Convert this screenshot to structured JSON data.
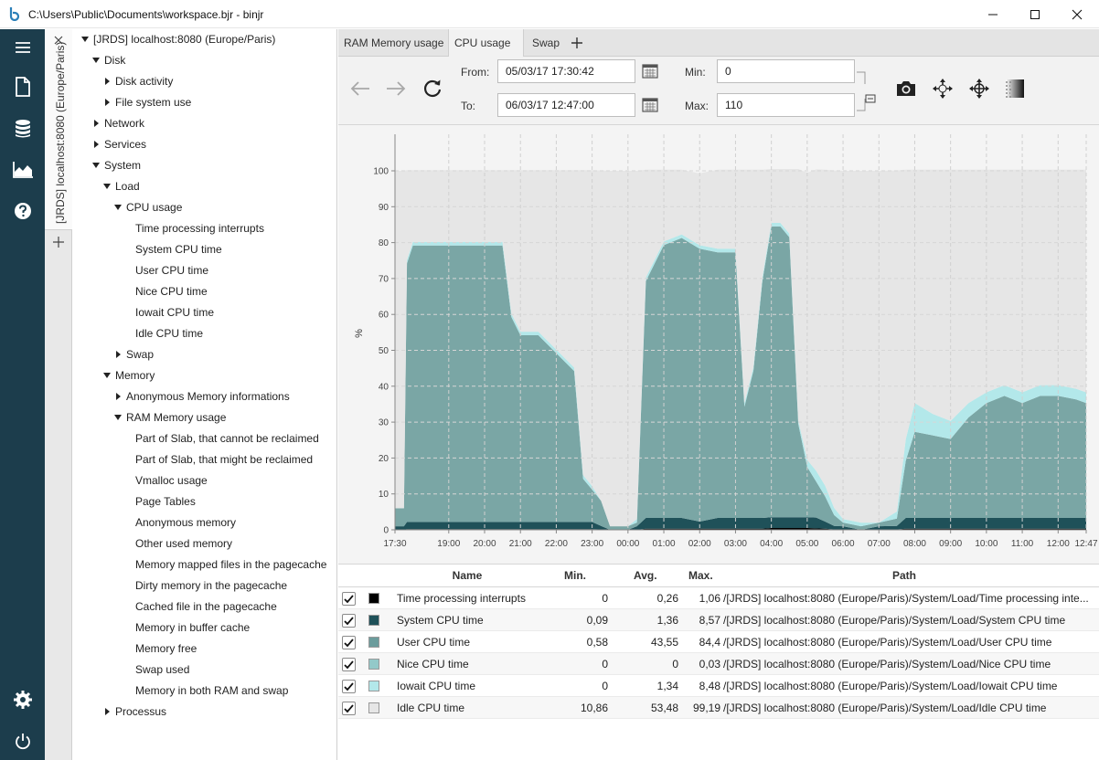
{
  "window": {
    "title": "C:\\Users\\Public\\Documents\\workspace.bjr - binjr",
    "buttons": {
      "minimize_icon": "minimize-icon",
      "maximize_icon": "maximize-icon",
      "close_icon": "close-icon"
    }
  },
  "nav": {
    "items": [
      "menu-icon",
      "new-document-icon",
      "database-icon",
      "chart-area-icon",
      "help-icon"
    ],
    "bottom": [
      "settings-icon",
      "power-icon"
    ]
  },
  "source": {
    "tab_label": "[JRDS] localhost:8080 (Europe/Paris)"
  },
  "tree": [
    {
      "label": "[JRDS] localhost:8080 (Europe/Paris)",
      "arrow": "down"
    },
    {
      "label": "Disk",
      "arrow": "down"
    },
    {
      "label": "Disk activity",
      "arrow": "right"
    },
    {
      "label": "File system use",
      "arrow": "right"
    },
    {
      "label": "Network",
      "arrow": "right"
    },
    {
      "label": "Services",
      "arrow": "right"
    },
    {
      "label": "System",
      "arrow": "down"
    },
    {
      "label": "Load",
      "arrow": "down"
    },
    {
      "label": "CPU usage",
      "arrow": "down"
    },
    {
      "label": "Time processing interrupts",
      "arrow": "none"
    },
    {
      "label": "System CPU time",
      "arrow": "none"
    },
    {
      "label": "User CPU time",
      "arrow": "none"
    },
    {
      "label": "Nice CPU time",
      "arrow": "none"
    },
    {
      "label": "Iowait CPU time",
      "arrow": "none"
    },
    {
      "label": "Idle CPU time",
      "arrow": "none"
    },
    {
      "label": "Swap",
      "arrow": "right"
    },
    {
      "label": "Memory",
      "arrow": "down"
    },
    {
      "label": "Anonymous Memory informations",
      "arrow": "right"
    },
    {
      "label": "RAM Memory usage",
      "arrow": "down"
    },
    {
      "label": "Part of Slab, that cannot be reclaimed",
      "arrow": "none"
    },
    {
      "label": "Part of Slab, that might be reclaimed",
      "arrow": "none"
    },
    {
      "label": "Vmalloc usage",
      "arrow": "none"
    },
    {
      "label": "Page Tables",
      "arrow": "none"
    },
    {
      "label": "Anonymous memory",
      "arrow": "none"
    },
    {
      "label": "Other used memory",
      "arrow": "none"
    },
    {
      "label": "Memory mapped files in the pagecache",
      "arrow": "none"
    },
    {
      "label": "Dirty memory in the pagecache",
      "arrow": "none"
    },
    {
      "label": "Cached file in the pagecache",
      "arrow": "none"
    },
    {
      "label": "Memory in buffer cache",
      "arrow": "none"
    },
    {
      "label": "Memory free",
      "arrow": "none"
    },
    {
      "label": "Swap used",
      "arrow": "none"
    },
    {
      "label": "Memory in both RAM and swap",
      "arrow": "none"
    },
    {
      "label": "Processus",
      "arrow": "right"
    }
  ],
  "tabs": [
    {
      "label": "RAM Memory usage",
      "active": false
    },
    {
      "label": "CPU usage",
      "active": true
    },
    {
      "label": "Swap",
      "active": false
    }
  ],
  "toolbar": {
    "from_label": "From:",
    "from_value": "05/03/17 17:30:42",
    "to_label": "To:",
    "to_value": "06/03/17 12:47:00",
    "min_label": "Min:",
    "min_value": "0",
    "max_label": "Max:",
    "max_value": "110"
  },
  "chart_data": {
    "type": "area",
    "ylabel": "%",
    "ylim": [
      0,
      100
    ],
    "yticks": [
      "0",
      "10",
      "20",
      "30",
      "40",
      "50",
      "60",
      "70",
      "80",
      "90",
      "100"
    ],
    "xticks": [
      "17:30",
      "19:00",
      "20:00",
      "21:00",
      "22:00",
      "23:00",
      "00:00",
      "01:00",
      "02:00",
      "03:00",
      "04:00",
      "05:00",
      "06:00",
      "07:00",
      "08:00",
      "09:00",
      "10:00",
      "11:00",
      "12:00",
      "12:47"
    ],
    "x": [
      "17:30",
      "17:45",
      "17:50",
      "18:00",
      "18:30",
      "19:00",
      "19:30",
      "20:00",
      "20:30",
      "20:45",
      "21:00",
      "21:30",
      "22:00",
      "22:30",
      "22:45",
      "23:00",
      "23:15",
      "23:30",
      "23:45",
      "00:00",
      "00:15",
      "00:30",
      "01:00",
      "01:30",
      "02:00",
      "02:30",
      "03:00",
      "03:15",
      "03:30",
      "03:45",
      "04:00",
      "04:15",
      "04:30",
      "04:45",
      "05:00",
      "05:15",
      "05:30",
      "05:45",
      "06:00",
      "06:30",
      "07:00",
      "07:30",
      "07:45",
      "08:00",
      "08:30",
      "09:00",
      "09:30",
      "10:00",
      "10:30",
      "11:00",
      "11:30",
      "12:00",
      "12:30",
      "12:47"
    ],
    "series": [
      {
        "name": "Idle CPU time",
        "color": "#e6e6e6",
        "values": [
          94,
          94,
          25,
          20,
          20,
          20,
          20,
          20,
          20,
          40,
          45,
          45,
          50,
          55,
          85,
          88,
          92,
          99,
          99,
          99,
          97,
          30,
          20,
          18,
          20,
          22,
          22,
          65,
          55,
          30,
          15,
          15,
          18,
          70,
          80,
          84,
          88,
          94,
          97,
          98,
          98,
          95,
          75,
          65,
          68,
          70,
          65,
          62,
          60,
          62,
          60,
          60,
          61,
          62
        ]
      },
      {
        "name": "Iowait CPU time",
        "color": "#b3e8ea",
        "values": [
          0,
          0,
          1,
          1,
          1,
          1,
          1,
          1,
          1,
          1,
          1,
          1,
          1,
          1,
          1,
          1,
          0,
          0,
          0,
          0,
          1,
          1,
          1,
          1,
          1,
          1,
          1,
          1,
          1,
          1,
          1,
          1,
          1,
          1,
          2,
          3,
          3,
          2,
          1,
          1,
          0,
          2,
          6,
          8,
          6,
          5,
          4,
          3,
          3,
          3,
          3,
          3,
          3,
          3
        ]
      },
      {
        "name": "Nice CPU time",
        "color": "#93c9c9",
        "values": [
          0,
          0,
          0,
          0,
          0,
          0,
          0,
          0,
          0,
          0,
          0,
          0,
          0,
          0,
          0,
          0,
          0,
          0,
          0,
          0,
          0,
          0,
          0,
          0,
          0,
          0,
          0,
          0,
          0,
          0,
          0,
          0,
          0,
          0,
          0,
          0,
          0,
          0,
          0,
          0,
          0,
          0,
          0,
          0,
          0,
          0,
          0,
          0,
          0,
          0,
          0,
          0,
          0,
          0
        ]
      },
      {
        "name": "User CPU time",
        "color": "#7aa6a5",
        "values": [
          5,
          5,
          72,
          77,
          77,
          77,
          77,
          77,
          77,
          57,
          52,
          52,
          47,
          42,
          12,
          9,
          7,
          1,
          1,
          1,
          1,
          66,
          76,
          78,
          76,
          74,
          74,
          31,
          41,
          66,
          81,
          81,
          78,
          26,
          14,
          10,
          7,
          3,
          1,
          1,
          1,
          2,
          16,
          24,
          23,
          22,
          28,
          32,
          34,
          32,
          34,
          34,
          33,
          32
        ]
      },
      {
        "name": "System CPU time",
        "color": "#1f5159",
        "values": [
          1,
          1,
          2,
          2,
          2,
          2,
          2,
          2,
          2,
          2,
          2,
          2,
          2,
          2,
          2,
          2,
          1,
          0,
          0,
          0,
          1,
          3,
          3,
          3,
          2,
          3,
          3,
          3,
          3,
          3,
          3,
          3,
          3,
          3,
          3,
          3,
          2,
          1,
          1,
          0,
          1,
          1,
          3,
          3,
          3,
          3,
          3,
          3,
          3,
          3,
          3,
          3,
          3,
          3
        ]
      },
      {
        "name": "Time processing interrupts",
        "color": "#000000",
        "values": [
          0,
          0,
          0.2,
          0.2,
          0.2,
          0.2,
          0.2,
          0.2,
          0.2,
          0.2,
          0.2,
          0.2,
          0.2,
          0.2,
          0.2,
          0.2,
          0.1,
          0,
          0,
          0,
          0,
          0.3,
          0.3,
          0.3,
          0.3,
          0.3,
          0.3,
          0.3,
          0.3,
          0.3,
          0.5,
          0.5,
          0.5,
          0.5,
          0.5,
          0.4,
          0.3,
          0.1,
          0,
          0,
          0,
          0.1,
          0.3,
          0.3,
          0.3,
          0.3,
          0.3,
          0.3,
          0.3,
          0.3,
          0.3,
          0.3,
          0.3,
          0.3
        ]
      }
    ],
    "grid": true
  },
  "table": {
    "headers": {
      "name": "Name",
      "min": "Min.",
      "avg": "Avg.",
      "max": "Max.",
      "path": "Path"
    },
    "rows": [
      {
        "name": "Time processing interrupts",
        "min": "0",
        "avg": "0,26",
        "max": "1,06",
        "path": "/[JRDS] localhost:8080 (Europe/Paris)/System/Load/Time processing inte...",
        "color": "#000000",
        "checked": true
      },
      {
        "name": "System CPU time",
        "min": "0,09",
        "avg": "1,36",
        "max": "8,57",
        "path": "/[JRDS] localhost:8080 (Europe/Paris)/System/Load/System CPU time",
        "color": "#1f5159",
        "checked": true
      },
      {
        "name": "User CPU time",
        "min": "0,58",
        "avg": "43,55",
        "max": "84,4",
        "path": "/[JRDS] localhost:8080 (Europe/Paris)/System/Load/User CPU time",
        "color": "#6b9c9c",
        "checked": true
      },
      {
        "name": "Nice CPU time",
        "min": "0",
        "avg": "0",
        "max": "0,03",
        "path": "/[JRDS] localhost:8080 (Europe/Paris)/System/Load/Nice CPU time",
        "color": "#93c9c9",
        "checked": true
      },
      {
        "name": "Iowait CPU time",
        "min": "0",
        "avg": "1,34",
        "max": "8,48",
        "path": "/[JRDS] localhost:8080 (Europe/Paris)/System/Load/Iowait CPU time",
        "color": "#b3e8ea",
        "checked": true
      },
      {
        "name": "Idle CPU time",
        "min": "10,86",
        "avg": "53,48",
        "max": "99,19",
        "path": "/[JRDS] localhost:8080 (Europe/Paris)/System/Load/Idle CPU time",
        "color": "#e6e6e6",
        "checked": true
      }
    ]
  }
}
